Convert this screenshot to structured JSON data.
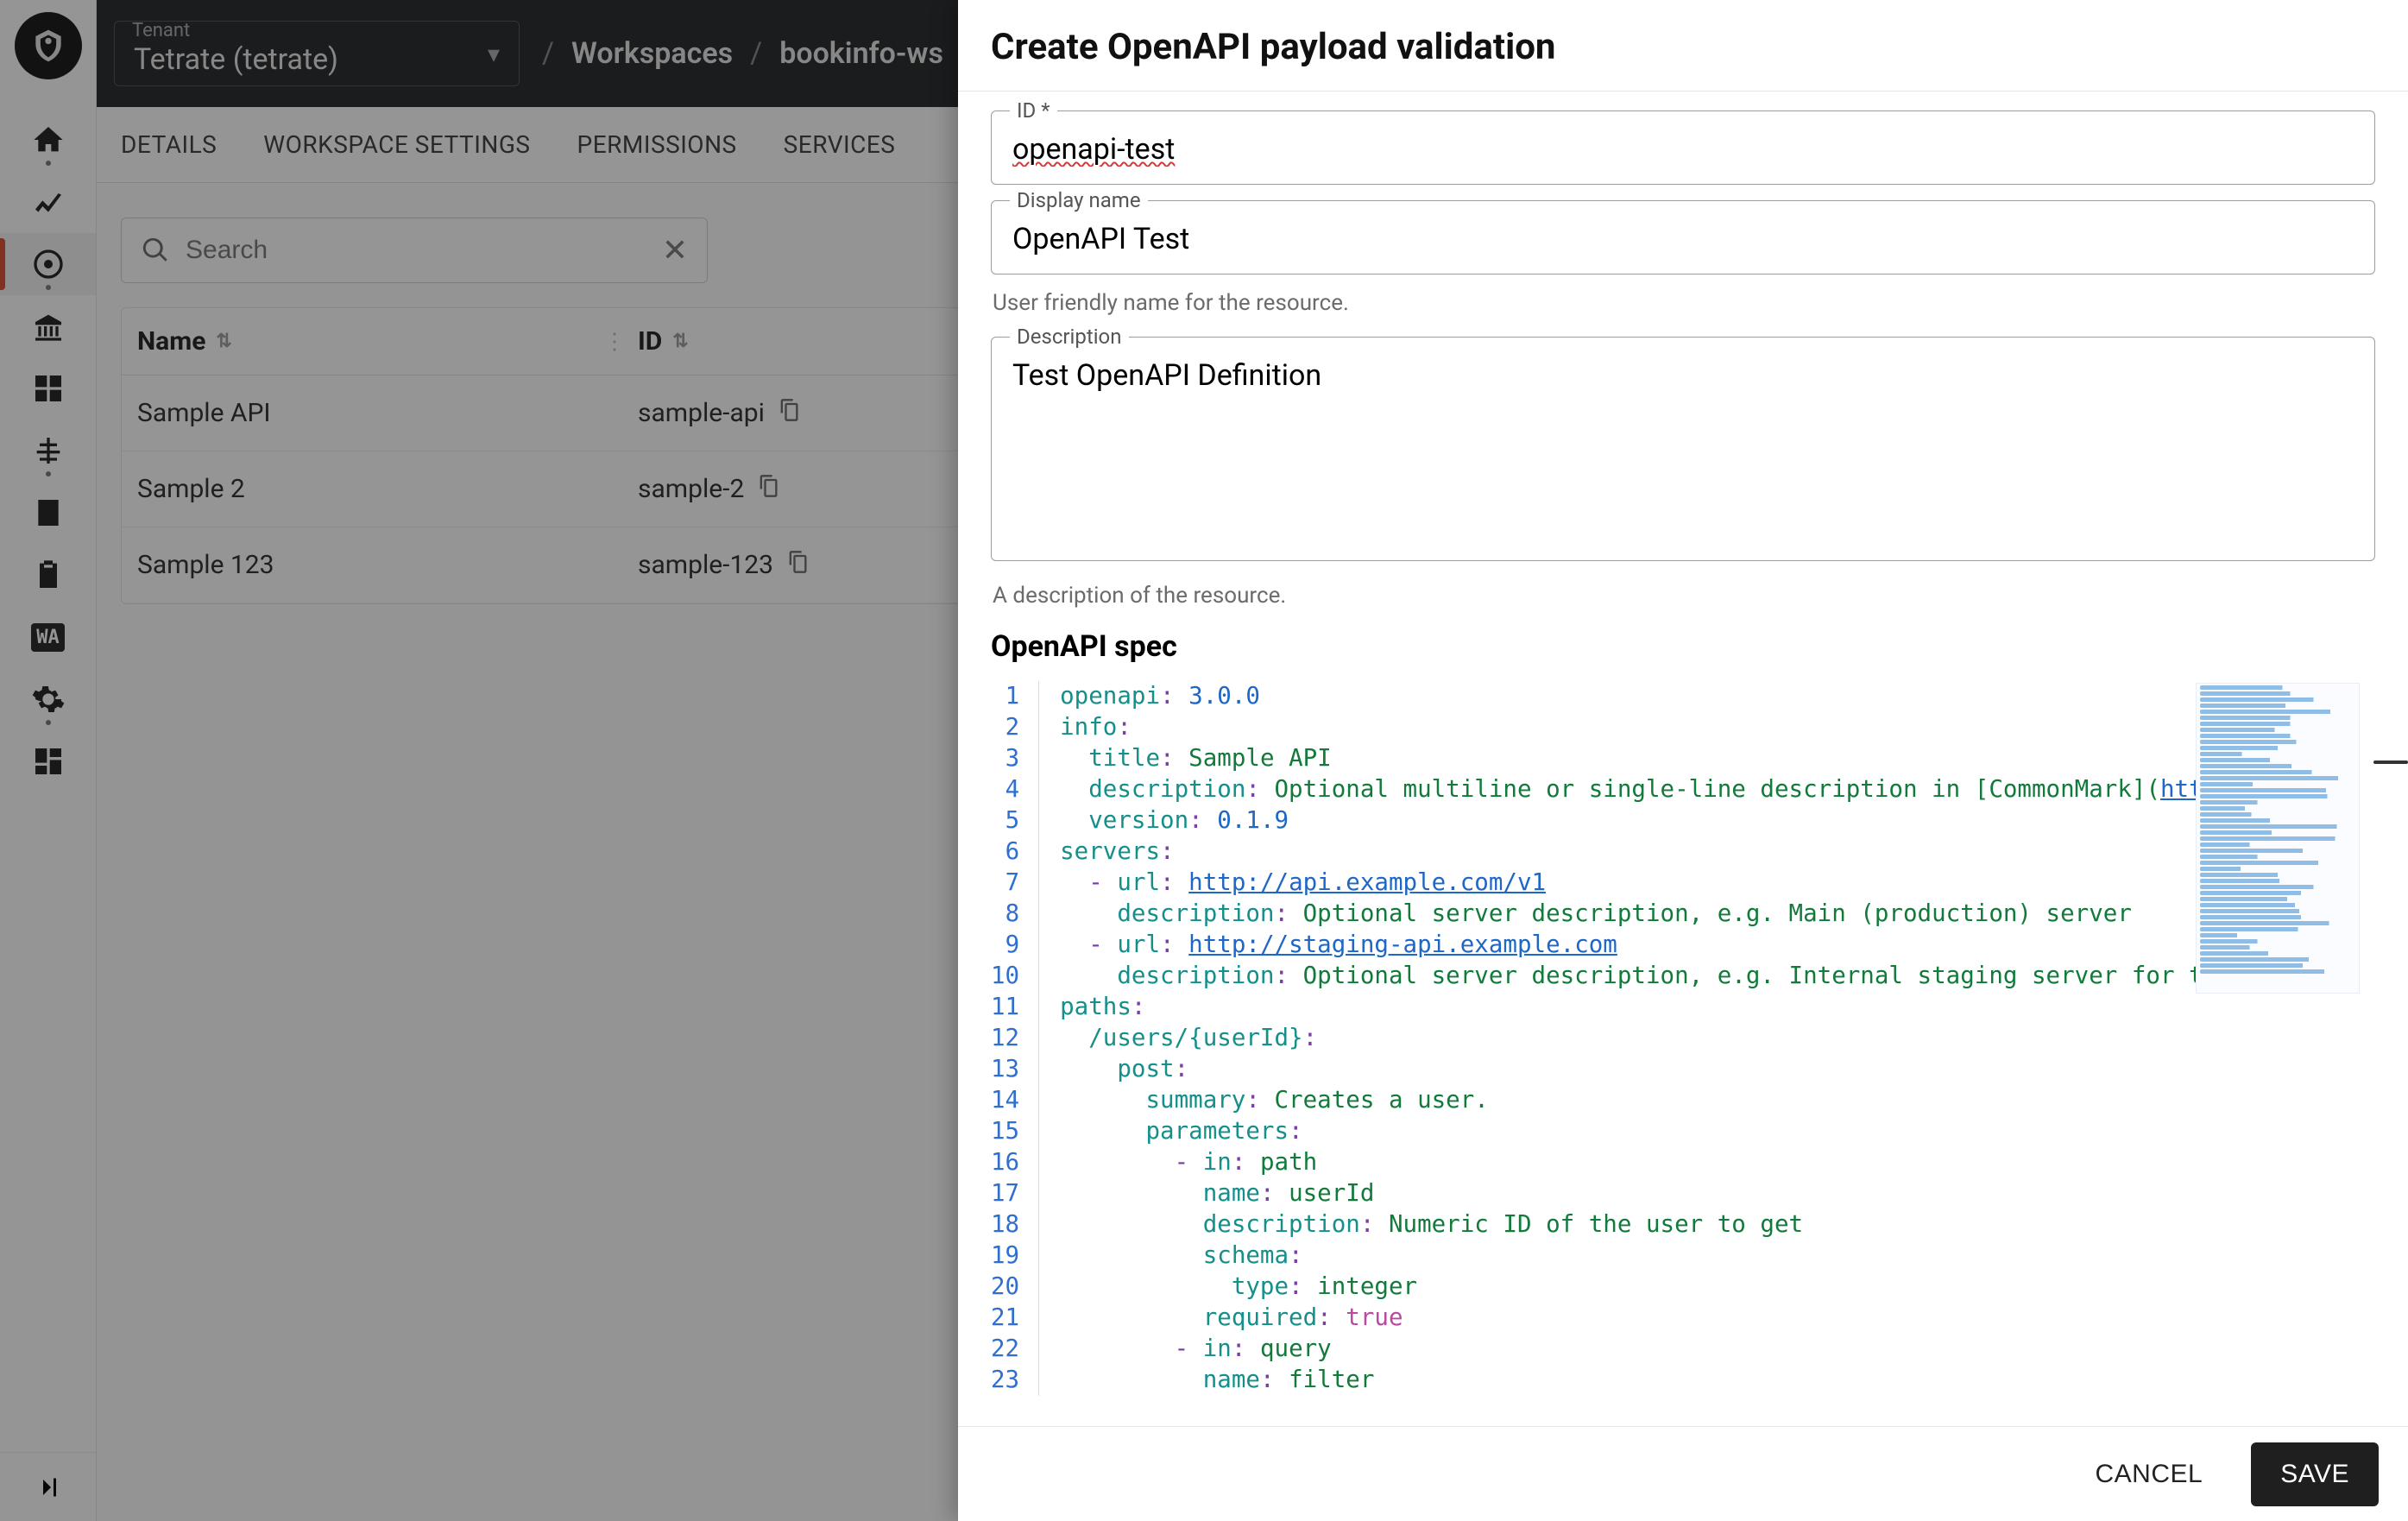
{
  "topbar": {
    "tenant_label": "Tenant",
    "tenant_value": "Tetrate (tetrate)",
    "crumbs": [
      "Workspaces",
      "bookinfo-ws"
    ]
  },
  "tabs": [
    "DETAILS",
    "WORKSPACE SETTINGS",
    "PERMISSIONS",
    "SERVICES"
  ],
  "search": {
    "placeholder": "Search"
  },
  "columns": {
    "name": "Name",
    "id": "ID"
  },
  "rows": [
    {
      "name": "Sample API",
      "id": "sample-api"
    },
    {
      "name": "Sample 2",
      "id": "sample-2"
    },
    {
      "name": "Sample 123",
      "id": "sample-123"
    }
  ],
  "drawer": {
    "title": "Create OpenAPI payload validation",
    "id_label": "ID *",
    "id_value": "openapi-test",
    "display_label": "Display name",
    "display_value": "OpenAPI Test",
    "display_helper": "User friendly name for the resource.",
    "desc_label": "Description",
    "desc_value": "Test OpenAPI Definition",
    "desc_helper": "A description of the resource.",
    "spec_title": "OpenAPI spec",
    "cancel": "CANCEL",
    "save": "SAVE",
    "code": [
      [
        [
          "key",
          "openapi"
        ],
        [
          "punc",
          ":"
        ],
        [
          "plain",
          " "
        ],
        [
          "num",
          "3.0.0"
        ]
      ],
      [
        [
          "key",
          "info"
        ],
        [
          "punc",
          ":"
        ]
      ],
      [
        [
          "plain",
          "  "
        ],
        [
          "key",
          "title"
        ],
        [
          "punc",
          ":"
        ],
        [
          "plain",
          " "
        ],
        [
          "str",
          "Sample API"
        ]
      ],
      [
        [
          "plain",
          "  "
        ],
        [
          "key",
          "description"
        ],
        [
          "punc",
          ":"
        ],
        [
          "plain",
          " "
        ],
        [
          "str",
          "Optional multiline or single-line description in [CommonMark]("
        ],
        [
          "url",
          "http://comm"
        ]
      ],
      [
        [
          "plain",
          "  "
        ],
        [
          "key",
          "version"
        ],
        [
          "punc",
          ":"
        ],
        [
          "plain",
          " "
        ],
        [
          "num",
          "0.1.9"
        ]
      ],
      [
        [
          "key",
          "servers"
        ],
        [
          "punc",
          ":"
        ]
      ],
      [
        [
          "plain",
          "  "
        ],
        [
          "punc",
          "-"
        ],
        [
          "plain",
          " "
        ],
        [
          "key",
          "url"
        ],
        [
          "punc",
          ":"
        ],
        [
          "plain",
          " "
        ],
        [
          "url",
          "http://api.example.com/v1"
        ]
      ],
      [
        [
          "plain",
          "    "
        ],
        [
          "key",
          "description"
        ],
        [
          "punc",
          ":"
        ],
        [
          "plain",
          " "
        ],
        [
          "str",
          "Optional server description, e.g. Main (production) server"
        ]
      ],
      [
        [
          "plain",
          "  "
        ],
        [
          "punc",
          "-"
        ],
        [
          "plain",
          " "
        ],
        [
          "key",
          "url"
        ],
        [
          "punc",
          ":"
        ],
        [
          "plain",
          " "
        ],
        [
          "url",
          "http://staging-api.example.com"
        ]
      ],
      [
        [
          "plain",
          "    "
        ],
        [
          "key",
          "description"
        ],
        [
          "punc",
          ":"
        ],
        [
          "plain",
          " "
        ],
        [
          "str",
          "Optional server description, e.g. Internal staging server for testing"
        ]
      ],
      [
        [
          "key",
          "paths"
        ],
        [
          "punc",
          ":"
        ]
      ],
      [
        [
          "plain",
          "  "
        ],
        [
          "key",
          "/users/{userId}"
        ],
        [
          "punc",
          ":"
        ]
      ],
      [
        [
          "plain",
          "    "
        ],
        [
          "key",
          "post"
        ],
        [
          "punc",
          ":"
        ]
      ],
      [
        [
          "plain",
          "      "
        ],
        [
          "key",
          "summary"
        ],
        [
          "punc",
          ":"
        ],
        [
          "plain",
          " "
        ],
        [
          "str",
          "Creates a user."
        ]
      ],
      [
        [
          "plain",
          "      "
        ],
        [
          "key",
          "parameters"
        ],
        [
          "punc",
          ":"
        ]
      ],
      [
        [
          "plain",
          "        "
        ],
        [
          "punc",
          "-"
        ],
        [
          "plain",
          " "
        ],
        [
          "key",
          "in"
        ],
        [
          "punc",
          ":"
        ],
        [
          "plain",
          " "
        ],
        [
          "str",
          "path"
        ]
      ],
      [
        [
          "plain",
          "          "
        ],
        [
          "key",
          "name"
        ],
        [
          "punc",
          ":"
        ],
        [
          "plain",
          " "
        ],
        [
          "str",
          "userId"
        ]
      ],
      [
        [
          "plain",
          "          "
        ],
        [
          "key",
          "description"
        ],
        [
          "punc",
          ":"
        ],
        [
          "plain",
          " "
        ],
        [
          "str",
          "Numeric ID of the user to get"
        ]
      ],
      [
        [
          "plain",
          "          "
        ],
        [
          "key",
          "schema"
        ],
        [
          "punc",
          ":"
        ]
      ],
      [
        [
          "plain",
          "            "
        ],
        [
          "key",
          "type"
        ],
        [
          "punc",
          ":"
        ],
        [
          "plain",
          " "
        ],
        [
          "str",
          "integer"
        ]
      ],
      [
        [
          "plain",
          "          "
        ],
        [
          "key",
          "required"
        ],
        [
          "punc",
          ":"
        ],
        [
          "plain",
          " "
        ],
        [
          "bool",
          "true"
        ]
      ],
      [
        [
          "plain",
          "        "
        ],
        [
          "punc",
          "-"
        ],
        [
          "plain",
          " "
        ],
        [
          "key",
          "in"
        ],
        [
          "punc",
          ":"
        ],
        [
          "plain",
          " "
        ],
        [
          "str",
          "query"
        ]
      ],
      [
        [
          "plain",
          "          "
        ],
        [
          "key",
          "name"
        ],
        [
          "punc",
          ":"
        ],
        [
          "plain",
          " "
        ],
        [
          "str",
          "filter"
        ]
      ]
    ]
  }
}
